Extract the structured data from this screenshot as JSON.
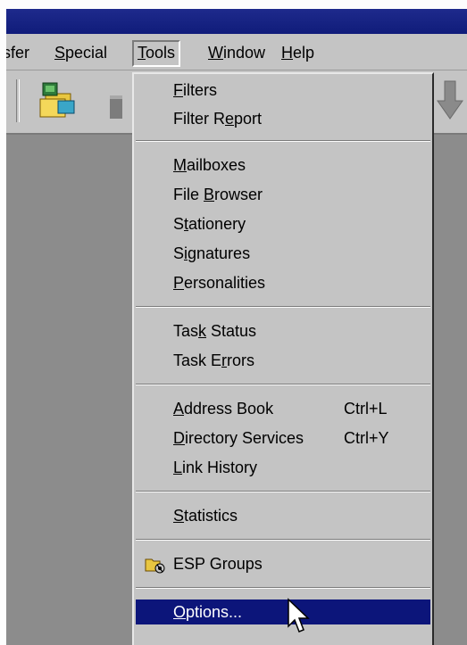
{
  "menubar": {
    "items": [
      {
        "label": "sfer"
      },
      {
        "label": "Special",
        "ul": "S",
        "rest": "pecial"
      },
      {
        "label": "Tools",
        "ul": "T",
        "rest": "ools"
      },
      {
        "label": "Window",
        "ul": "W",
        "rest": "indow"
      },
      {
        "label": "Help",
        "ul": "H",
        "rest": "elp"
      }
    ]
  },
  "menu": {
    "filters": {
      "ul": "F",
      "rest": "ilters"
    },
    "filter_report": {
      "pre": "Filter R",
      "ul": "e",
      "rest": "port"
    },
    "mailboxes": {
      "ul": "M",
      "rest": "ailboxes"
    },
    "file_browser": {
      "pre": "File ",
      "ul": "B",
      "rest": "rowser"
    },
    "stationery": {
      "pre": "S",
      "ul": "t",
      "rest": "ationery"
    },
    "signatures": {
      "pre": "S",
      "ul": "i",
      "rest": "gnatures"
    },
    "personalities": {
      "ul": "P",
      "rest": "ersonalities"
    },
    "task_status": {
      "pre": "Tas",
      "ul": "k",
      "rest": " Status"
    },
    "task_errors": {
      "pre": "Task E",
      "ul": "r",
      "rest": "rors"
    },
    "address_book": {
      "ul": "A",
      "rest": "ddress Book",
      "shortcut": "Ctrl+L"
    },
    "directory_services": {
      "ul": "D",
      "rest": "irectory Services",
      "shortcut": "Ctrl+Y"
    },
    "link_history": {
      "ul": "L",
      "rest": "ink History"
    },
    "statistics": {
      "ul": "S",
      "rest": "tatistics"
    },
    "esp_groups": {
      "label": "ESP Groups"
    },
    "options": {
      "ul": "O",
      "rest": "ptions..."
    }
  },
  "colors": {
    "titlebar": "#101c7a",
    "menu_bg": "#c4c4c4",
    "selection": "#0c157a",
    "workspace": "#8c8c8c"
  },
  "icons": [
    "mailbox-icon",
    "toolbar-icon-partial",
    "down-arrow-icon",
    "esp-groups-icon",
    "mouse-cursor-icon"
  ]
}
